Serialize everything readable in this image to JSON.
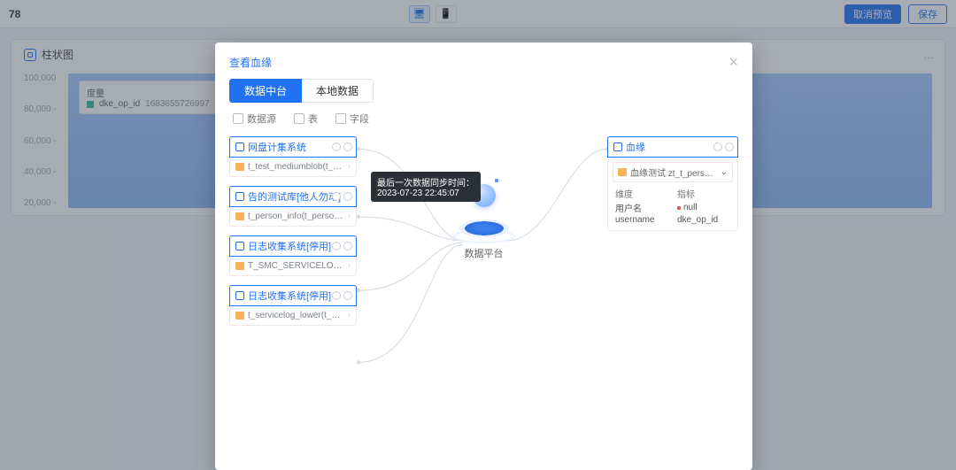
{
  "topbar": {
    "page_number": "78",
    "cancel_label": "取消预览",
    "save_label": "保存"
  },
  "card": {
    "title": "柱状图",
    "badge_label": "dke_op_id",
    "more": "…"
  },
  "chart_data": {
    "type": "bar",
    "ylabel": "",
    "y_ticks": [
      "100,000",
      "80,000 -",
      "60,000 -",
      "40,000 -",
      "20,000 -"
    ],
    "ylim": [
      0,
      100000
    ],
    "legend": {
      "title": "度量",
      "series_name": "dke_op_id",
      "series_value": "1683655726997"
    }
  },
  "modal": {
    "title": "查看血缘",
    "tabs": [
      "数据中台",
      "本地数据"
    ],
    "filters": [
      "数据源",
      "表",
      "字段"
    ],
    "center_label": "数据平台",
    "tooltip_line1": "最后一次数据同步时间：",
    "tooltip_line2": "2023-07-23 22:45:07",
    "sources": [
      {
        "head": "网盘计集系统",
        "table": "t_test_mediumblob(t_test_mediumblob)"
      },
      {
        "head": "告的测试库[他人勿动]",
        "table": "t_person_info(t_person_info)"
      },
      {
        "head": "日志收集系统[停用]",
        "table": "T_SMC_SERVICELOG_HISTORY(T_SMC_SERVICELOG_HISTORY)"
      },
      {
        "head": "日志收集系统[停用]",
        "table": "t_servicelog_lower(t_servicelog_lo"
      }
    ],
    "target": {
      "head": "血缘",
      "select_label": "血缘测试 zt_t_person_info",
      "col1_head": "维度",
      "col2_head": "指标",
      "rows": [
        {
          "dim": "用户名",
          "met": "null"
        },
        {
          "dim": "username",
          "met": "dke_op_id"
        }
      ]
    }
  }
}
